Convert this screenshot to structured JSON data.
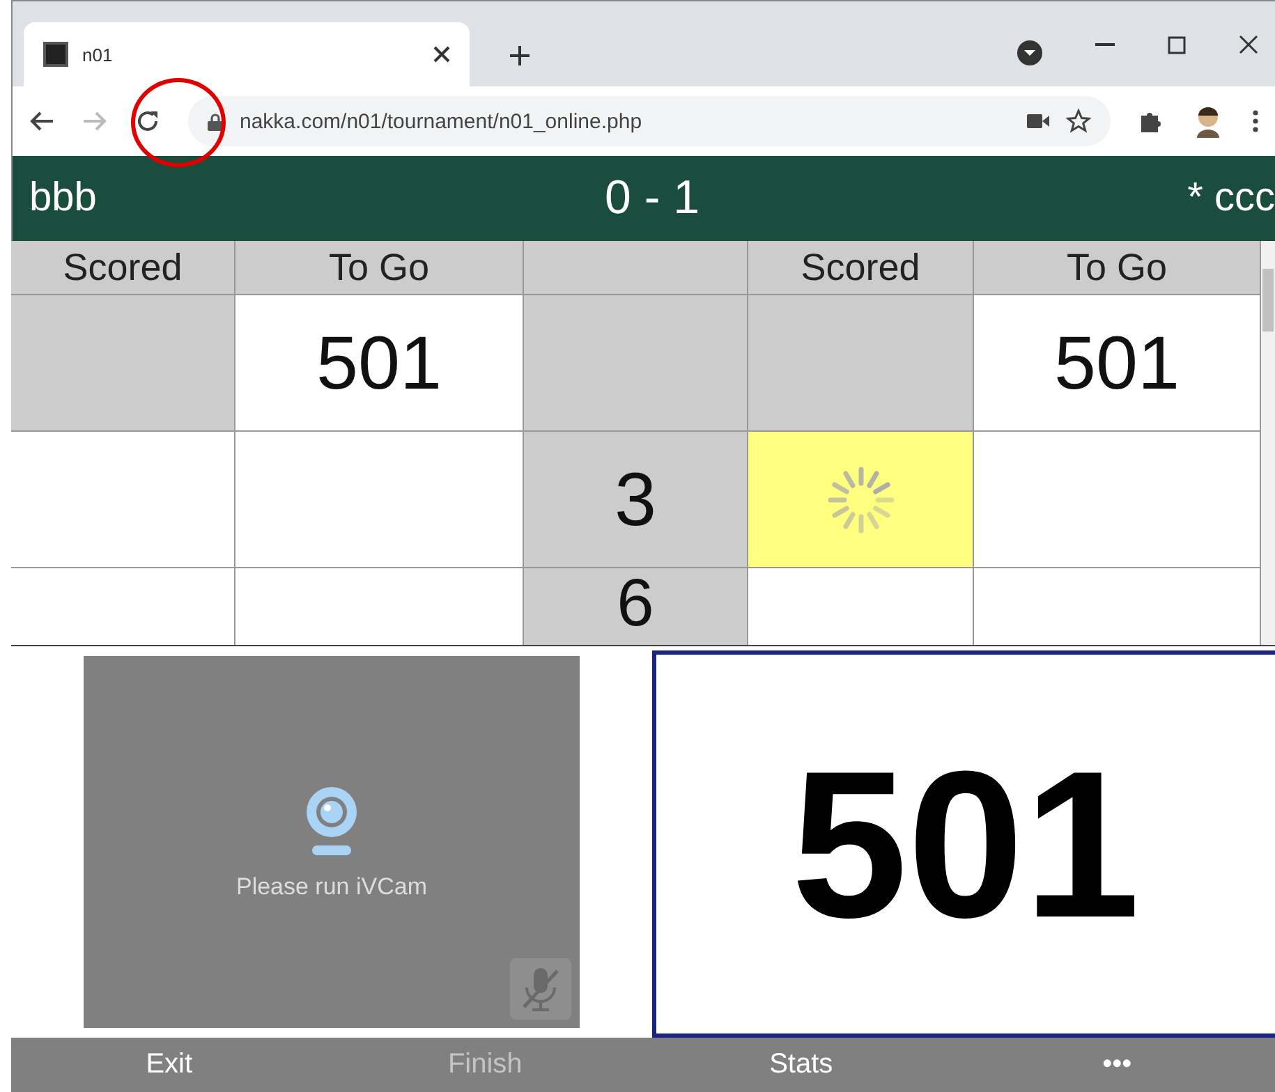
{
  "browser": {
    "tab": {
      "title": "n01"
    },
    "url": "nakka.com/n01/tournament/n01_online.php",
    "annotation": {
      "kind": "circle",
      "color": "#e00000"
    }
  },
  "match": {
    "left_player": "bbb",
    "score": "0 - 1",
    "right_player": "* ccc"
  },
  "table": {
    "left_columns": [
      "Scored",
      "To Go"
    ],
    "right_columns": [
      "Scored",
      "To Go"
    ],
    "rows": [
      {
        "kind": "start",
        "left_to_go": "501",
        "right_to_go": "501"
      },
      {
        "kind": "turn",
        "round": "3",
        "pending": true
      },
      {
        "kind": "turn",
        "round": "6",
        "pending": false
      }
    ]
  },
  "webcam": {
    "message": "Please run iVCam",
    "muted": true
  },
  "remaining": "501",
  "buttons": [
    {
      "label": "Exit",
      "disabled": false
    },
    {
      "label": "Finish",
      "disabled": true
    },
    {
      "label": "Stats",
      "disabled": false
    },
    {
      "label": "•••",
      "disabled": false
    }
  ]
}
